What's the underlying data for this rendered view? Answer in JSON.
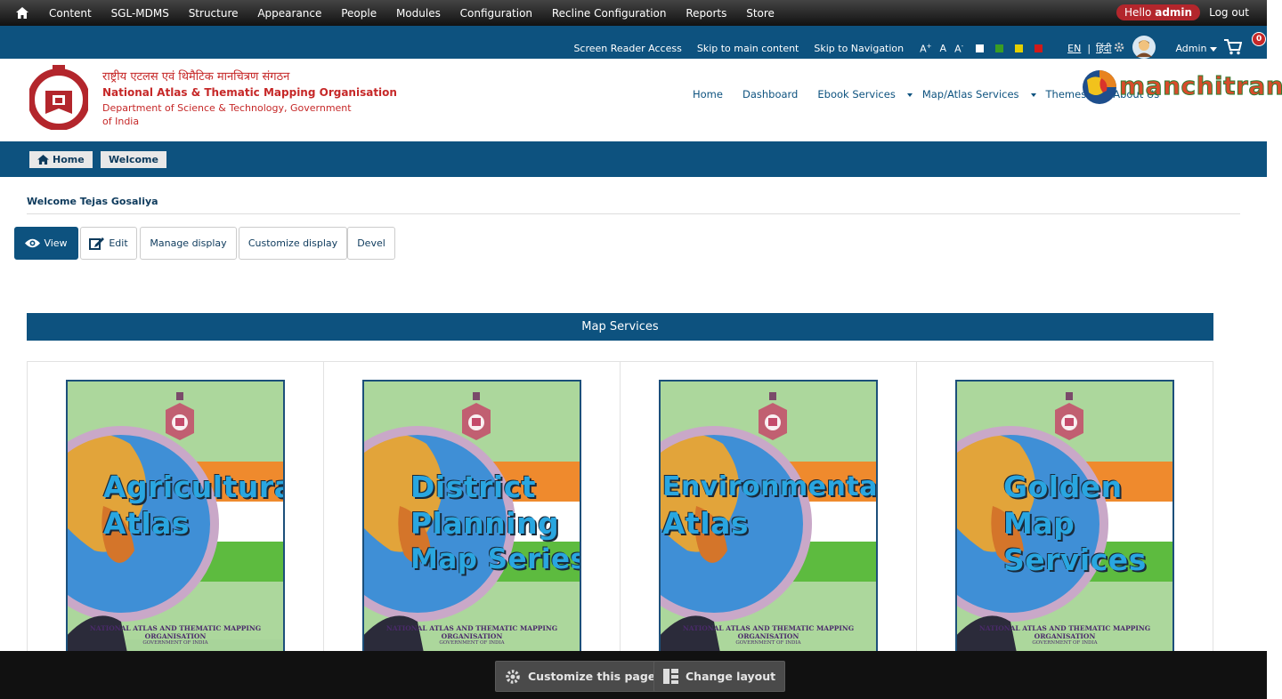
{
  "admin_bar": {
    "menu": [
      "Content",
      "SGL-MDMS",
      "Structure",
      "Appearance",
      "People",
      "Modules",
      "Configuration",
      "Recline Configuration",
      "Reports",
      "Store"
    ],
    "hello_prefix": "Hello",
    "hello_user": "admin",
    "logout": "Log out"
  },
  "access_bar": {
    "screen_reader": "Screen Reader Access",
    "skip_main": "Skip to main content",
    "skip_nav": "Skip to Navigation",
    "font_increase": "A+",
    "font_normal": "A",
    "font_decrease": "A-",
    "lang_en": "EN",
    "lang_hi": "हिंदी",
    "user": "Admin",
    "cart_count": "0",
    "color_options": [
      "#ffffff",
      "#3a9d23",
      "#e3d000",
      "#d01a1a"
    ]
  },
  "header": {
    "org_hindi": "राष्ट्रीय एटलस एवं थिमैटिक मानचित्रण संगठन",
    "org_english": "National Atlas & Thematic Mapping Organisation",
    "department": "Department of Science & Technology, Government of India",
    "nav": [
      {
        "label": "Home",
        "dropdown": false
      },
      {
        "label": "Dashboard",
        "dropdown": false
      },
      {
        "label": "Ebook Services",
        "dropdown": true
      },
      {
        "label": "Map/Atlas Services",
        "dropdown": true
      },
      {
        "label": "Themes",
        "dropdown": true
      },
      {
        "label": "About Us",
        "dropdown": false
      }
    ],
    "logo_text": "manchitran"
  },
  "breadcrumb": {
    "home": "Home",
    "current": "Welcome"
  },
  "page": {
    "welcome": "Welcome Tejas Gosaliya",
    "tabs": [
      "View",
      "Edit",
      "Manage display",
      "Customize display",
      "Devel"
    ],
    "section_title": "Map Services"
  },
  "cards": [
    {
      "lines": [
        "Agricultural",
        "Atlas"
      ]
    },
    {
      "lines": [
        "District",
        "Planning",
        "Map Series"
      ]
    },
    {
      "lines": [
        "Environmental",
        "Atlas"
      ]
    },
    {
      "lines": [
        "Golden",
        "Map",
        "Services"
      ]
    }
  ],
  "cover_footer": {
    "org": "NATIONAL ATLAS AND THEMATIC MAPPING ORGANISATION",
    "gov": "GOVERNMENT OF INDIA"
  },
  "bottom_bar": {
    "customize": "Customize this page",
    "layout": "Change layout"
  }
}
